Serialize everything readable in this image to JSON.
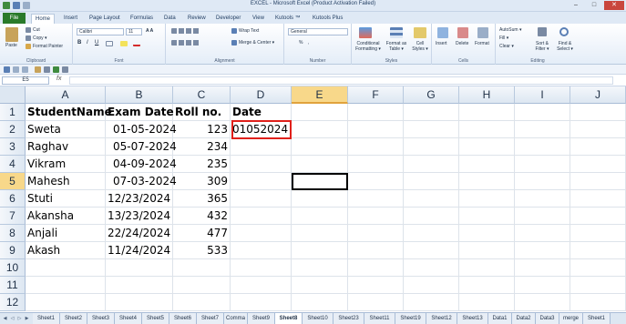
{
  "window": {
    "title": "EXCEL - Microsoft Excel (Product Activation Failed)",
    "min": "–",
    "max": "□",
    "close": "✕"
  },
  "ribbon_tabs": [
    "File",
    "Home",
    "Insert",
    "Page Layout",
    "Formulas",
    "Data",
    "Review",
    "Developer",
    "View",
    "Kutools ™",
    "Kutools Plus"
  ],
  "ribbon": {
    "clipboard": {
      "paste": "Paste",
      "cut": "Cut",
      "copy": "Copy ▾",
      "format_painter": "Format Painter",
      "label": "Clipboard"
    },
    "font": {
      "name": "Calibri",
      "size": "11",
      "label": "Font",
      "bold": "B",
      "italic": "I",
      "underline": "U"
    },
    "alignment": {
      "wrap": "Wrap Text",
      "merge": "Merge & Center ▾",
      "label": "Alignment"
    },
    "number": {
      "format": "General",
      "pct": "%",
      "comma": ",",
      "label": "Number"
    },
    "styles": {
      "conditional": "Conditional Formatting ▾",
      "format_table": "Format as Table ▾",
      "cell_styles": "Cell Styles ▾",
      "label": "Styles"
    },
    "cells": {
      "insert": "Insert",
      "delete": "Delete",
      "format": "Format",
      "label": "Cells"
    },
    "editing": {
      "autosum": "AutoSum ▾",
      "fill": "Fill ▾",
      "clear": "Clear ▾",
      "sort": "Sort & Filter ▾",
      "find": "Find & Select ▾",
      "label": "Editing"
    }
  },
  "name_box": "E5",
  "fx": "fx",
  "formula": "",
  "columns": [
    "A",
    "B",
    "C",
    "D",
    "E",
    "F",
    "G",
    "H",
    "I",
    "J"
  ],
  "rows": [
    "1",
    "2",
    "3",
    "4",
    "5",
    "6",
    "7",
    "8",
    "9",
    "10",
    "11",
    "12"
  ],
  "cells": {
    "A1": "StudentName",
    "B1": "Exam Date",
    "C1": "Roll no.",
    "D1": "Date",
    "A2": "Sweta",
    "B2": "01-05-2024",
    "C2": "123",
    "D2": "01052024",
    "A3": "Raghav",
    "B3": "05-07-2024",
    "C3": "234",
    "A4": "Vikram",
    "B4": "04-09-2024",
    "C4": "235",
    "A5": "Mahesh",
    "B5": "07-03-2024",
    "C5": "309",
    "A6": "Stuti",
    "B6": "12/23/2024",
    "C6": "365",
    "A7": "Akansha",
    "B7": "13/23/2024",
    "C7": "432",
    "A8": "Anjali",
    "B8": "22/24/2024",
    "C8": "477",
    "A9": "Akash",
    "B9": "11/24/2024",
    "C9": "533"
  },
  "sheet_tabs": [
    "Sheet1",
    "Sheet2",
    "Sheet3",
    "Sheet4",
    "Sheet5",
    "Sheet6",
    "Sheet7",
    "Comma",
    "Sheet9",
    "Sheet8",
    "Sheet10",
    "Sheet23",
    "Sheet11",
    "Sheet19",
    "Sheet12",
    "Sheet13",
    "Data1",
    "Data2",
    "Data3",
    "merge",
    "Sheet1"
  ],
  "active_sheet": "Sheet8",
  "colors": {
    "file_tab": "#2a7a2a",
    "highlight": "#e0201b",
    "selection": "#f8d88a"
  }
}
